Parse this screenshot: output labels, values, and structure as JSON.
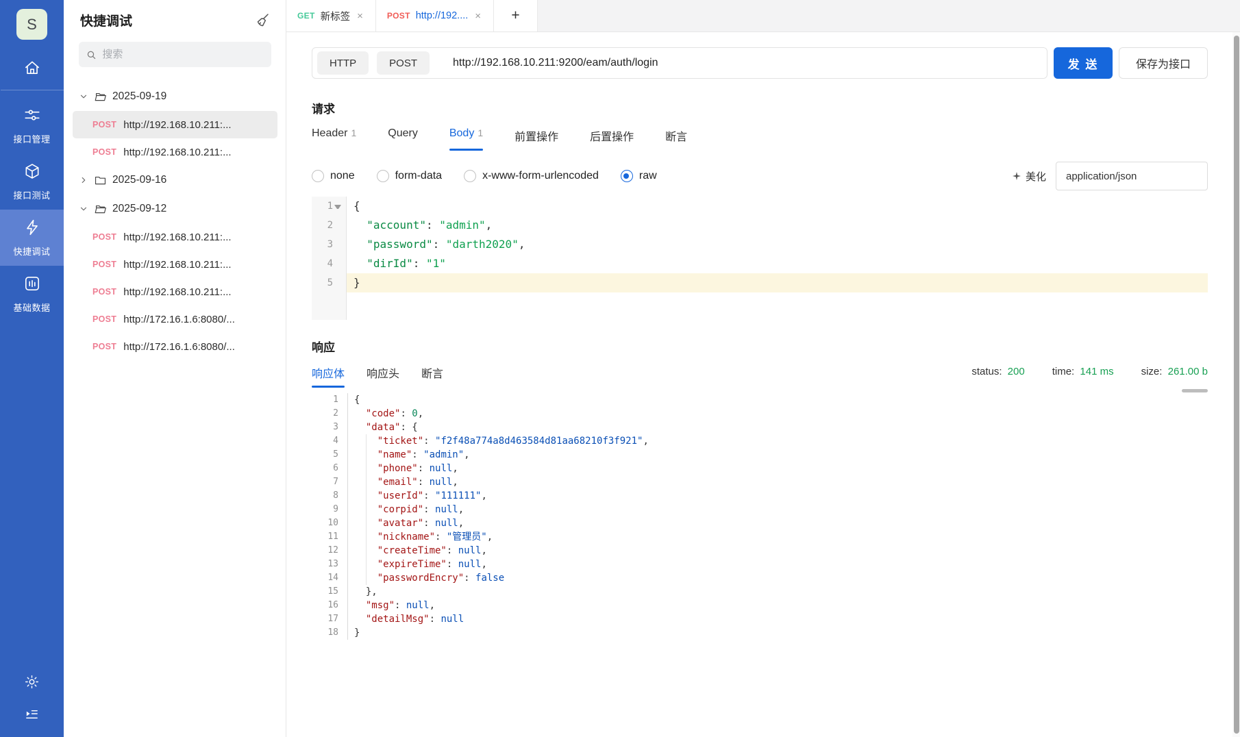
{
  "rail": {
    "logo": "S",
    "items": [
      {
        "label": "接口管理",
        "icon": "sliders-icon",
        "active": false
      },
      {
        "label": "接口测试",
        "icon": "cube-icon",
        "active": false
      },
      {
        "label": "快捷调试",
        "icon": "bolt-icon",
        "active": true
      },
      {
        "label": "基础数据",
        "icon": "bars-icon",
        "active": false
      }
    ]
  },
  "panel": {
    "title": "快捷调试",
    "search_placeholder": "搜索",
    "tree": [
      {
        "label": "2025-09-19",
        "expanded": true,
        "children": [
          {
            "method": "POST",
            "url": "http://192.168.10.211:...",
            "selected": true
          },
          {
            "method": "POST",
            "url": "http://192.168.10.211:...",
            "selected": false
          }
        ]
      },
      {
        "label": "2025-09-16",
        "expanded": false,
        "children": []
      },
      {
        "label": "2025-09-12",
        "expanded": true,
        "children": [
          {
            "method": "POST",
            "url": "http://192.168.10.211:...",
            "selected": false
          },
          {
            "method": "POST",
            "url": "http://192.168.10.211:...",
            "selected": false
          },
          {
            "method": "POST",
            "url": "http://192.168.10.211:...",
            "selected": false
          },
          {
            "method": "POST",
            "url": "http://172.16.1.6:8080/...",
            "selected": false
          },
          {
            "method": "POST",
            "url": "http://172.16.1.6:8080/...",
            "selected": false
          }
        ]
      }
    ]
  },
  "tabs": {
    "items": [
      {
        "method": "GET",
        "label": "新标签",
        "close": "×",
        "active": false
      },
      {
        "method": "POST",
        "label": "http://192....",
        "close": "×",
        "active": true
      }
    ],
    "add_label": "+"
  },
  "request": {
    "section_title": "请求",
    "protocol": "HTTP",
    "method": "POST",
    "url": "http://192.168.10.211:9200/eam/auth/login",
    "send_label": "发 送",
    "save_label": "保存为接口",
    "tabs": [
      {
        "label": "Header",
        "count": "1",
        "active": false
      },
      {
        "label": "Query",
        "count": "",
        "active": false
      },
      {
        "label": "Body",
        "count": "1",
        "active": true
      },
      {
        "label": "前置操作",
        "count": "",
        "active": false
      },
      {
        "label": "后置操作",
        "count": "",
        "active": false
      },
      {
        "label": "断言",
        "count": "",
        "active": false
      }
    ],
    "body_types": [
      {
        "label": "none",
        "selected": false
      },
      {
        "label": "form-data",
        "selected": false
      },
      {
        "label": "x-www-form-urlencoded",
        "selected": false
      },
      {
        "label": "raw",
        "selected": true
      }
    ],
    "beautify_label": "美化",
    "content_type": "application/json",
    "editor_lines": [
      {
        "num": "1",
        "fold": true,
        "highlight": false,
        "tokens": [
          {
            "t": "p",
            "v": "{"
          }
        ]
      },
      {
        "num": "2",
        "fold": false,
        "highlight": false,
        "tokens": [
          {
            "t": "p",
            "v": "  "
          },
          {
            "t": "k",
            "v": "\"account\""
          },
          {
            "t": "p",
            "v": ": "
          },
          {
            "t": "s",
            "v": "\"admin\""
          },
          {
            "t": "p",
            "v": ","
          }
        ]
      },
      {
        "num": "3",
        "fold": false,
        "highlight": false,
        "tokens": [
          {
            "t": "p",
            "v": "  "
          },
          {
            "t": "k",
            "v": "\"password\""
          },
          {
            "t": "p",
            "v": ": "
          },
          {
            "t": "s",
            "v": "\"darth2020\""
          },
          {
            "t": "p",
            "v": ","
          }
        ]
      },
      {
        "num": "4",
        "fold": false,
        "highlight": false,
        "tokens": [
          {
            "t": "p",
            "v": "  "
          },
          {
            "t": "k",
            "v": "\"dirId\""
          },
          {
            "t": "p",
            "v": ": "
          },
          {
            "t": "s",
            "v": "\"1\""
          }
        ]
      },
      {
        "num": "5",
        "fold": false,
        "highlight": true,
        "tokens": [
          {
            "t": "p",
            "v": "}"
          }
        ]
      }
    ]
  },
  "response": {
    "section_title": "响应",
    "tabs": [
      {
        "label": "响应体",
        "active": true
      },
      {
        "label": "响应头",
        "active": false
      },
      {
        "label": "断言",
        "active": false
      }
    ],
    "meta": [
      {
        "label": "status:",
        "value": "200"
      },
      {
        "label": "time:",
        "value": "141 ms"
      },
      {
        "label": "size:",
        "value": "261.00 b"
      }
    ],
    "lines": [
      {
        "num": "1",
        "indent": 0,
        "tokens": [
          {
            "t": "p",
            "v": "{"
          }
        ]
      },
      {
        "num": "2",
        "indent": 2,
        "tokens": [
          {
            "t": "k",
            "v": "\"code\""
          },
          {
            "t": "p",
            "v": ": "
          },
          {
            "t": "n",
            "v": "0"
          },
          {
            "t": "p",
            "v": ","
          }
        ]
      },
      {
        "num": "3",
        "indent": 2,
        "tokens": [
          {
            "t": "k",
            "v": "\"data\""
          },
          {
            "t": "p",
            "v": ": {"
          }
        ]
      },
      {
        "num": "4",
        "indent": 4,
        "tokens": [
          {
            "t": "k",
            "v": "\"ticket\""
          },
          {
            "t": "p",
            "v": ": "
          },
          {
            "t": "s",
            "v": "\"f2f48a774a8d463584d81aa68210f3f921\""
          },
          {
            "t": "p",
            "v": ","
          }
        ]
      },
      {
        "num": "5",
        "indent": 4,
        "tokens": [
          {
            "t": "k",
            "v": "\"name\""
          },
          {
            "t": "p",
            "v": ": "
          },
          {
            "t": "s",
            "v": "\"admin\""
          },
          {
            "t": "p",
            "v": ","
          }
        ]
      },
      {
        "num": "6",
        "indent": 4,
        "tokens": [
          {
            "t": "k",
            "v": "\"phone\""
          },
          {
            "t": "p",
            "v": ": "
          },
          {
            "t": "c",
            "v": "null"
          },
          {
            "t": "p",
            "v": ","
          }
        ]
      },
      {
        "num": "7",
        "indent": 4,
        "tokens": [
          {
            "t": "k",
            "v": "\"email\""
          },
          {
            "t": "p",
            "v": ": "
          },
          {
            "t": "c",
            "v": "null"
          },
          {
            "t": "p",
            "v": ","
          }
        ]
      },
      {
        "num": "8",
        "indent": 4,
        "tokens": [
          {
            "t": "k",
            "v": "\"userId\""
          },
          {
            "t": "p",
            "v": ": "
          },
          {
            "t": "s",
            "v": "\"111111\""
          },
          {
            "t": "p",
            "v": ","
          }
        ]
      },
      {
        "num": "9",
        "indent": 4,
        "tokens": [
          {
            "t": "k",
            "v": "\"corpid\""
          },
          {
            "t": "p",
            "v": ": "
          },
          {
            "t": "c",
            "v": "null"
          },
          {
            "t": "p",
            "v": ","
          }
        ]
      },
      {
        "num": "10",
        "indent": 4,
        "tokens": [
          {
            "t": "k",
            "v": "\"avatar\""
          },
          {
            "t": "p",
            "v": ": "
          },
          {
            "t": "c",
            "v": "null"
          },
          {
            "t": "p",
            "v": ","
          }
        ]
      },
      {
        "num": "11",
        "indent": 4,
        "tokens": [
          {
            "t": "k",
            "v": "\"nickname\""
          },
          {
            "t": "p",
            "v": ": "
          },
          {
            "t": "s",
            "v": "\"管理员\""
          },
          {
            "t": "p",
            "v": ","
          }
        ]
      },
      {
        "num": "12",
        "indent": 4,
        "tokens": [
          {
            "t": "k",
            "v": "\"createTime\""
          },
          {
            "t": "p",
            "v": ": "
          },
          {
            "t": "c",
            "v": "null"
          },
          {
            "t": "p",
            "v": ","
          }
        ]
      },
      {
        "num": "13",
        "indent": 4,
        "tokens": [
          {
            "t": "k",
            "v": "\"expireTime\""
          },
          {
            "t": "p",
            "v": ": "
          },
          {
            "t": "c",
            "v": "null"
          },
          {
            "t": "p",
            "v": ","
          }
        ]
      },
      {
        "num": "14",
        "indent": 4,
        "tokens": [
          {
            "t": "k",
            "v": "\"passwordEncry\""
          },
          {
            "t": "p",
            "v": ": "
          },
          {
            "t": "c",
            "v": "false"
          }
        ]
      },
      {
        "num": "15",
        "indent": 2,
        "tokens": [
          {
            "t": "p",
            "v": "},"
          }
        ]
      },
      {
        "num": "16",
        "indent": 2,
        "tokens": [
          {
            "t": "k",
            "v": "\"msg\""
          },
          {
            "t": "p",
            "v": ": "
          },
          {
            "t": "c",
            "v": "null"
          },
          {
            "t": "p",
            "v": ","
          }
        ]
      },
      {
        "num": "17",
        "indent": 2,
        "tokens": [
          {
            "t": "k",
            "v": "\"detailMsg\""
          },
          {
            "t": "p",
            "v": ": "
          },
          {
            "t": "c",
            "v": "null"
          }
        ]
      },
      {
        "num": "18",
        "indent": 0,
        "tokens": [
          {
            "t": "p",
            "v": "}"
          }
        ]
      }
    ]
  },
  "colors": {
    "accent": "#1667dc",
    "rail_bg": "#3261be",
    "get_green": "#45c998",
    "post_red": "#f05c56",
    "post_pink": "#ee7e93",
    "status_green": "#18a053",
    "json_key": "#a31515",
    "json_string": "#0a4fb5",
    "json_number": "#098658",
    "editor_green": "#10a150"
  }
}
